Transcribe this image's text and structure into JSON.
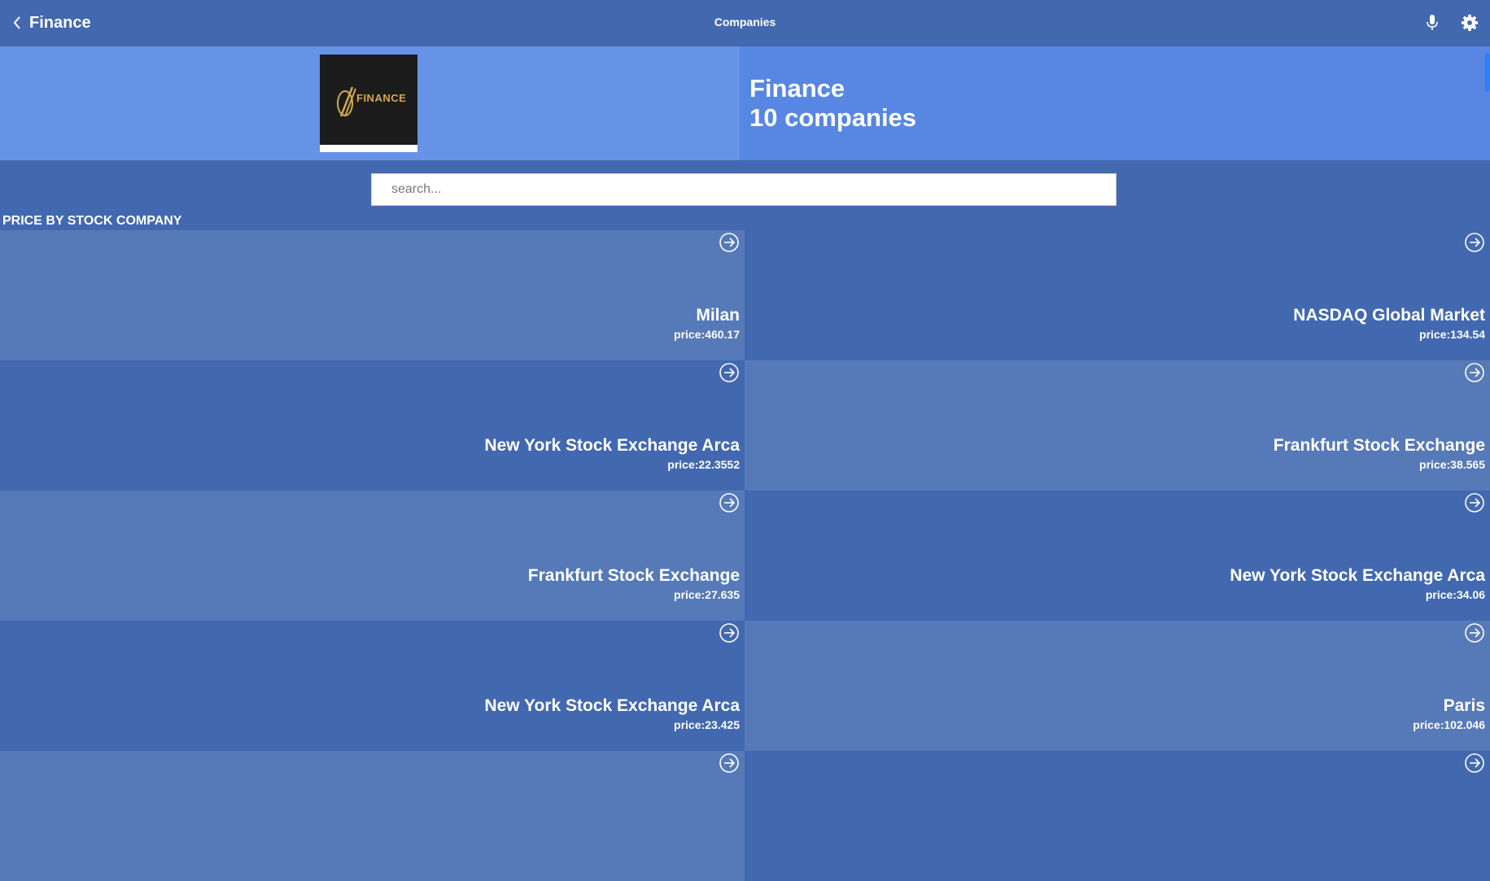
{
  "header": {
    "back_label": "Finance",
    "title": "Companies",
    "icons": [
      "chevron-left-icon",
      "microphone-icon",
      "gear-icon"
    ]
  },
  "hero": {
    "logo_word": "FINANCE",
    "name": "Finance",
    "count": "10 companies"
  },
  "search": {
    "placeholder": "search..."
  },
  "section": {
    "title": "PRICE BY STOCK COMPANY"
  },
  "tiles": [
    {
      "name": "Milan",
      "price": "price:460.17"
    },
    {
      "name": "NASDAQ Global Market",
      "price": "price:134.54"
    },
    {
      "name": "New York Stock Exchange Arca",
      "price": "price:22.3552"
    },
    {
      "name": "Frankfurt Stock Exchange",
      "price": "price:38.565"
    },
    {
      "name": "Frankfurt Stock Exchange",
      "price": "price:27.635"
    },
    {
      "name": "New York Stock Exchange Arca",
      "price": "price:34.06"
    },
    {
      "name": "New York Stock Exchange Arca",
      "price": "price:23.425"
    },
    {
      "name": "Paris",
      "price": "price:102.046"
    },
    {
      "name": "",
      "price": ""
    },
    {
      "name": "",
      "price": ""
    }
  ],
  "colors": {
    "background": "#4268b0",
    "tile_light": "#5679b8",
    "hero_left": "#6793e6",
    "hero_right": "#5787e2"
  }
}
